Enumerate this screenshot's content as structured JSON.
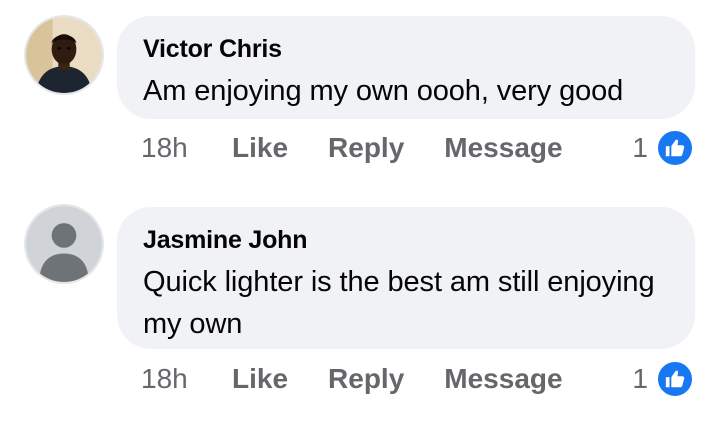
{
  "comments": [
    {
      "author": "Victor Chris",
      "text": "Am enjoying my own oooh, very good",
      "time": "18h",
      "actions": {
        "like": "Like",
        "reply": "Reply",
        "message": "Message"
      },
      "reaction_count": "1",
      "reaction_icon": "like-icon",
      "avatar": "profile-photo"
    },
    {
      "author": "Jasmine John",
      "text": "Quick lighter is the best am still enjoying my own",
      "time": "18h",
      "actions": {
        "like": "Like",
        "reply": "Reply",
        "message": "Message"
      },
      "reaction_count": "1",
      "reaction_icon": "like-icon",
      "avatar": "default-avatar"
    }
  ],
  "colors": {
    "bubble": "#f0f2f5",
    "meta_text": "#65676b",
    "like_blue": "#1877f2"
  }
}
